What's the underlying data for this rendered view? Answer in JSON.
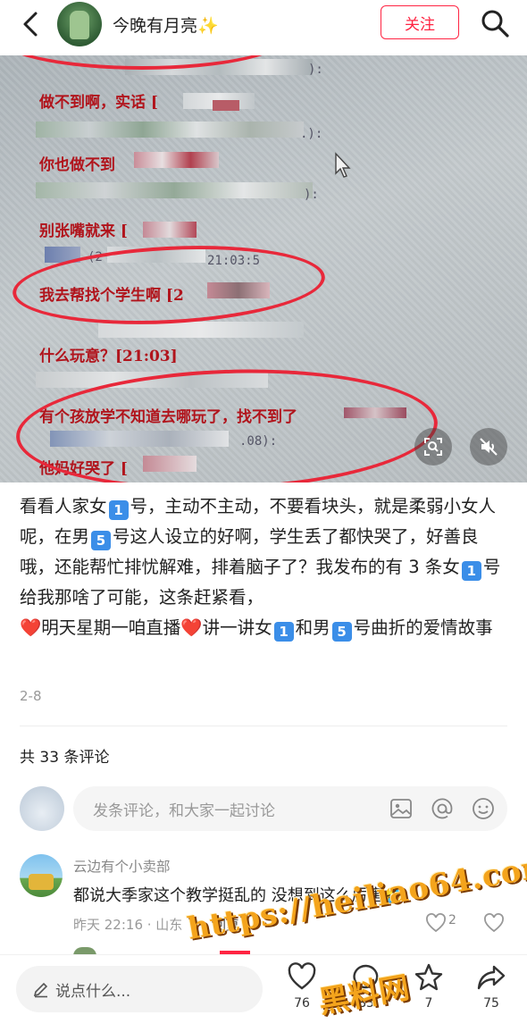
{
  "header": {
    "author_name": "今晚有月亮",
    "author_sparkle": "✨",
    "follow_label": "关注",
    "back_icon": "chevron-left-icon",
    "search_icon": "search-icon"
  },
  "photo": {
    "lines": [
      "做不到啊，实话 [",
      "你也做不到",
      "别张嘴就来 [",
      "我去帮找个学生啊 [2",
      "什么玩意？[21:03]",
      "有个孩放学不知道去哪玩了，找不到了",
      "他妈好哭了 ["
    ],
    "gray_fragments": [
      "):",
      ".):",
      "):",
      "(2",
      "21:03:5",
      ".08):"
    ],
    "icons": [
      "image-search-icon",
      "mute-icon"
    ]
  },
  "caption": {
    "p1": "看看人家女",
    "kb1": "1",
    "p2": "号，主动不主动，不要看块头，就是柔弱小女人呢，在男",
    "kb2": "5",
    "p3": "号这人设立的好啊，学生丢了都快哭了，好善良哦，还能帮忙排忧解难，排着脑子了？我发布的有 3 条女",
    "kb3": "1",
    "p4": "号给我那啥了可能，这条赶紧看，",
    "heart": "❤️",
    "p5": "明天星期一咱直播",
    "p6": "讲一讲女",
    "kb4": "1",
    "p7": "和男",
    "kb5": "5",
    "p8": "号曲折的爱情故事"
  },
  "post_date": "2-8",
  "comments_header": "共 33 条评论",
  "comment_input": {
    "placeholder": "发条评论，和大家一起讨论",
    "icons": [
      "image-icon",
      "mention-icon",
      "emoji-icon"
    ]
  },
  "comments": [
    {
      "name": "云边有个小卖部",
      "text": "都说大季家这个教学挺乱的 没想到这么厉害",
      "emoji": "🤣",
      "meta": "昨天 22:16 · 山东",
      "reply_label": "回复",
      "likes": "2"
    }
  ],
  "bottom_bar": {
    "say_placeholder": "说点什么...",
    "like_count": "76",
    "comment_count": "83",
    "collect_count": "7",
    "share_count": "75"
  },
  "watermark": {
    "url": "https://heiliao64.com",
    "name": "黑料网"
  },
  "colors": {
    "brand_red": "#ff2442",
    "caption_text": "#222222",
    "handwriting_red": "#e8283a",
    "photo_text_red": "#b1141c"
  }
}
